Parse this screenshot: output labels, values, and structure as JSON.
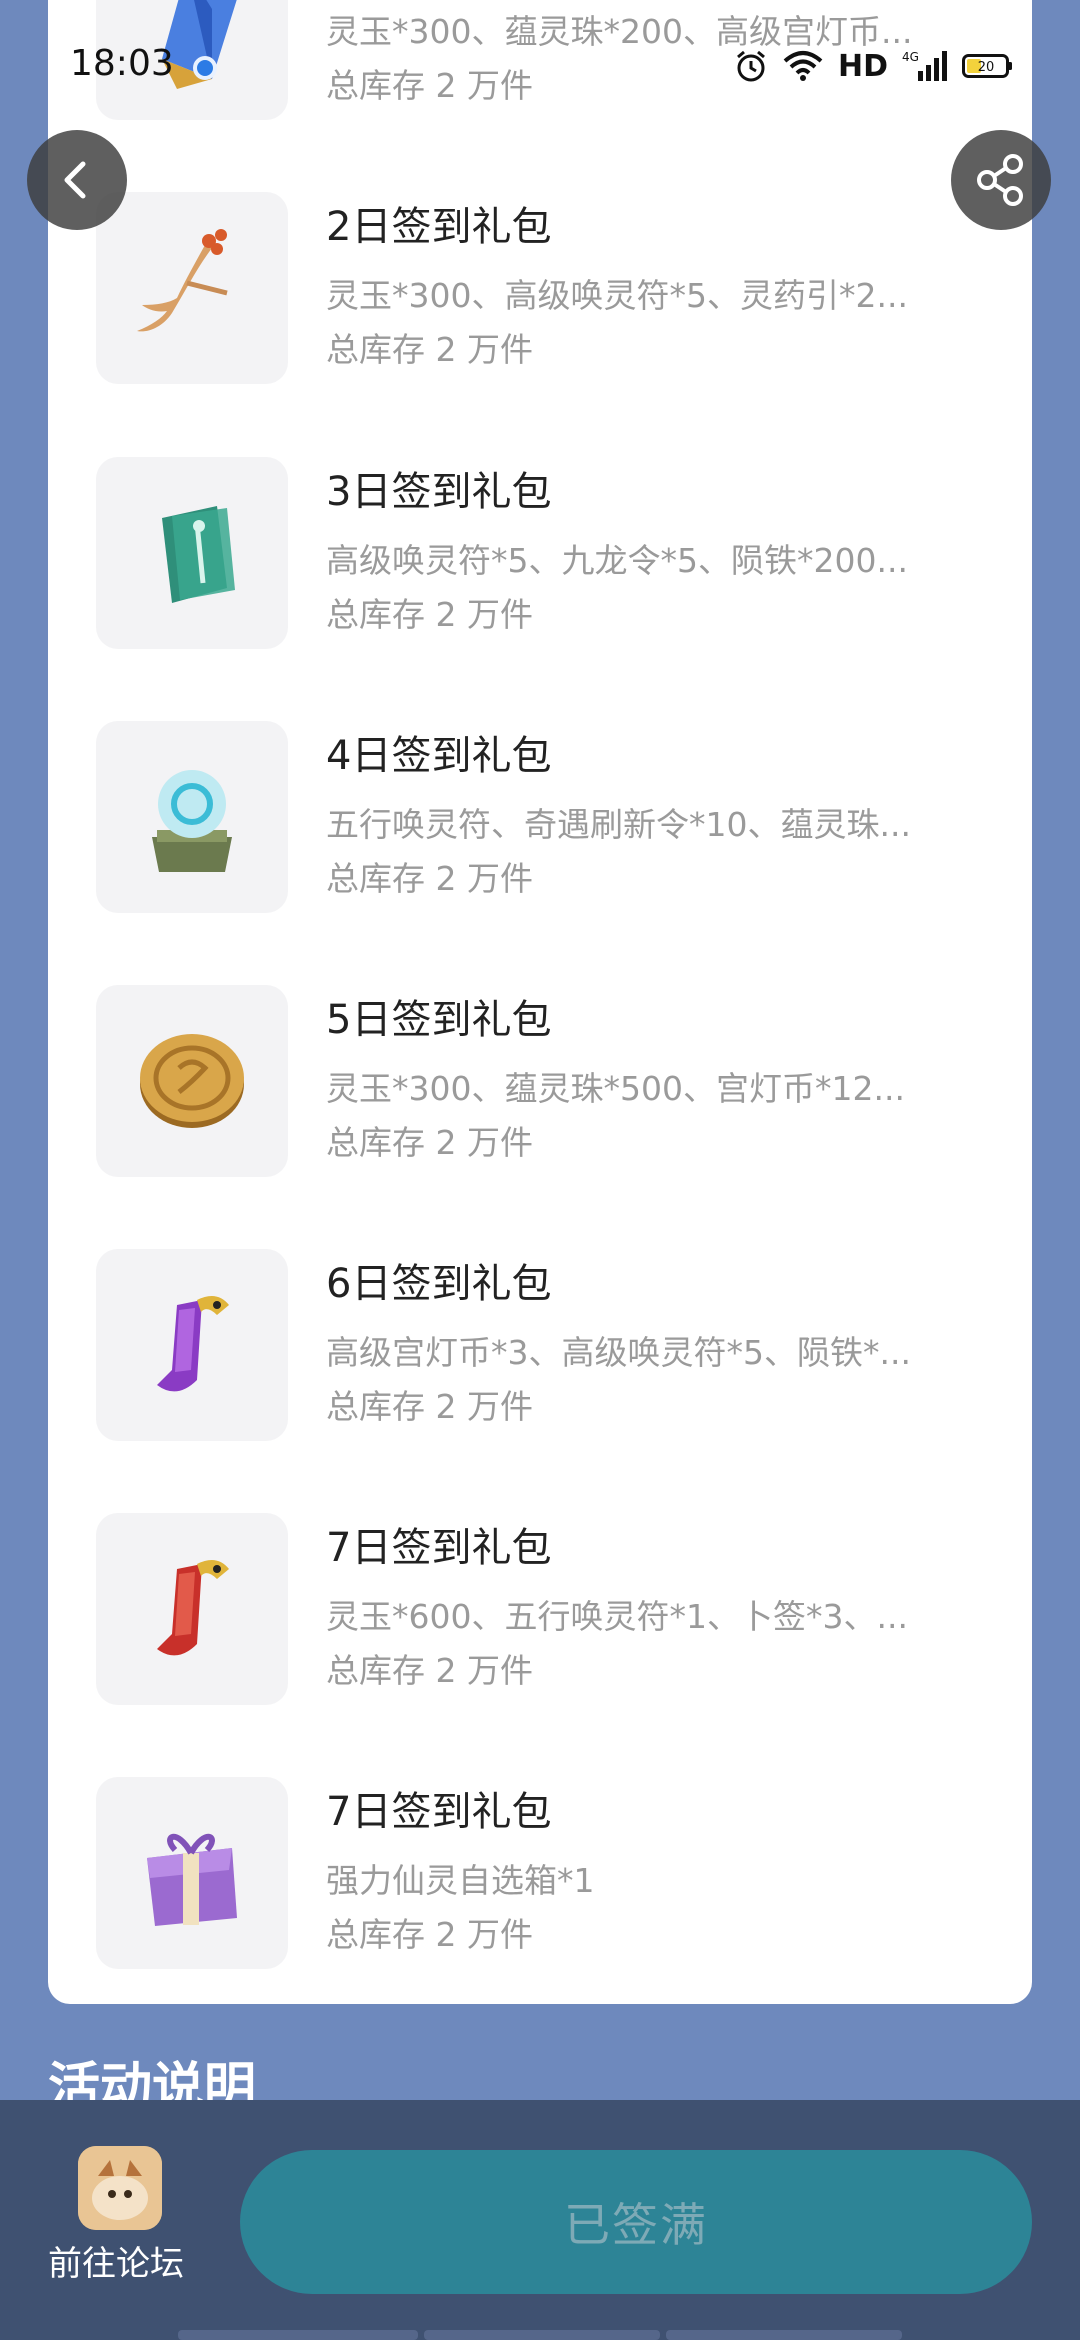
{
  "status_bar": {
    "time": "18:03",
    "battery": "20",
    "network": "HD",
    "signal": "4G"
  },
  "gifts": [
    {
      "title": "",
      "desc": "灵玉*300、蕴灵珠*200、高级宫灯币...",
      "stock": "总库存 2 万件",
      "icon": "crystal-icon"
    },
    {
      "title": "2日签到礼包",
      "desc": "灵玉*300、高级唤灵符*5、灵药引*2...",
      "stock": "总库存 2 万件",
      "icon": "ginseng-root-icon"
    },
    {
      "title": "3日签到礼包",
      "desc": "高级唤灵符*5、九龙令*5、陨铁*200...",
      "stock": "总库存 2 万件",
      "icon": "talisman-icon"
    },
    {
      "title": "4日签到礼包",
      "desc": "五行唤灵符、奇遇刷新令*10、蕴灵珠...",
      "stock": "总库存 2 万件",
      "icon": "orb-icon"
    },
    {
      "title": "5日签到礼包",
      "desc": "灵玉*300、蕴灵珠*500、宫灯币*12...",
      "stock": "总库存 2 万件",
      "icon": "coin-icon"
    },
    {
      "title": "6日签到礼包",
      "desc": "高级宫灯币*3、高级唤灵符*5、陨铁*...",
      "stock": "总库存 2 万件",
      "icon": "purple-scroll-icon"
    },
    {
      "title": "7日签到礼包",
      "desc": "灵玉*600、五行唤灵符*1、卜签*3、...",
      "stock": "总库存 2 万件",
      "icon": "red-scroll-icon"
    },
    {
      "title": "7日签到礼包",
      "desc": "强力仙灵自选箱*1",
      "stock": "总库存 2 万件",
      "icon": "gift-box-icon"
    }
  ],
  "section_heading": "活动说明",
  "bottom_bar": {
    "forum_label": "前往论坛",
    "signed_button": "已签满"
  },
  "colors": {
    "page_bg": "#6e89bd",
    "bottom_bar_bg": "#3f5171",
    "signed_button_bg": "#2d8496",
    "signed_button_text": "#7eaab6"
  }
}
